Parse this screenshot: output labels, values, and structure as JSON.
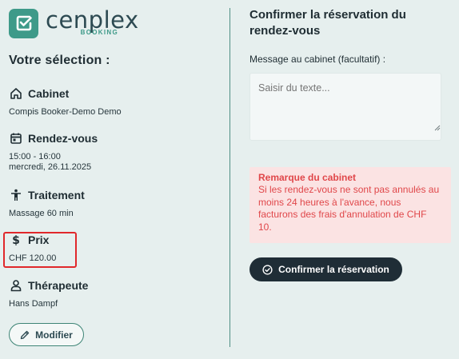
{
  "brand": {
    "name": "cenplex",
    "sub": "BOOKING",
    "color": "#3e9a89"
  },
  "selection": {
    "title": "Votre sélection :",
    "items": [
      {
        "label": "Cabinet",
        "icon": "home-icon",
        "value": "Compis Booker-Demo Demo"
      },
      {
        "label": "Rendez-vous",
        "icon": "calendar-icon",
        "value_time": "15:00 - 16:00",
        "value_date": "mercredi, 26.11.2025"
      },
      {
        "label": "Traitement",
        "icon": "person-icon",
        "value": "Massage 60 min"
      },
      {
        "label": "Prix",
        "icon": "dollar-icon",
        "value": "CHF 120.00"
      },
      {
        "label": "Thérapeute",
        "icon": "user-icon",
        "value": "Hans Dampf"
      }
    ],
    "modify_label": "Modifier"
  },
  "confirm": {
    "title": "Confirmer la réservation du rendez-vous",
    "message_label": "Message au cabinet (facultatif) :",
    "message_placeholder": "Saisir du texte...",
    "message_value": "",
    "notice_title": "Remarque du cabinet",
    "notice_text": "Si les rendez-vous ne sont pas annulés au moins 24 heures à l'avance, nous facturons des frais d'annulation de CHF 10.",
    "button_label": "Confirmer la réservation",
    "notice_color": "#e0474a",
    "button_color": "#1f2d36"
  }
}
